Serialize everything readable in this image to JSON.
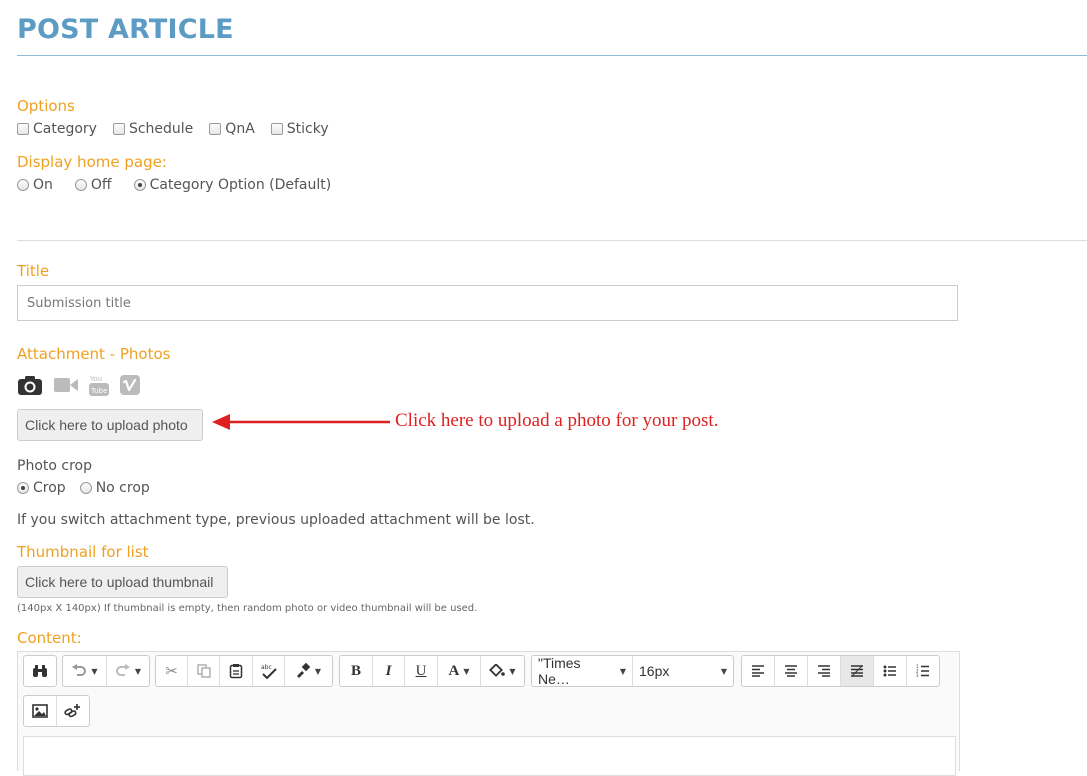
{
  "page": {
    "title": "POST ARTICLE"
  },
  "options": {
    "label": "Options",
    "checkboxes": [
      {
        "label": "Category",
        "checked": false
      },
      {
        "label": "Schedule",
        "checked": false
      },
      {
        "label": "QnA",
        "checked": false
      },
      {
        "label": "Sticky",
        "checked": false
      }
    ]
  },
  "display_home": {
    "label": "Display home page:",
    "radios": [
      {
        "label": "On",
        "selected": false
      },
      {
        "label": "Off",
        "selected": false
      },
      {
        "label": "Category Option (Default)",
        "selected": true
      }
    ]
  },
  "title_field": {
    "label": "Title",
    "placeholder": "Submission title"
  },
  "attachment": {
    "label": "Attachment - Photos",
    "types": [
      "camera-icon",
      "video-camera-icon",
      "youtube-icon",
      "vimeo-icon"
    ],
    "upload_label": "Click here to upload photo",
    "callout": "Click here to upload a photo for your post.",
    "crop_label": "Photo crop",
    "crop_options": [
      {
        "label": "Crop",
        "selected": true
      },
      {
        "label": "No crop",
        "selected": false
      }
    ],
    "warning": "If you switch attachment type, previous uploaded attachment will be lost."
  },
  "thumbnail": {
    "label": "Thumbnail for list",
    "upload_label": "Click here to upload thumbnail",
    "note": "(140px X 140px) If thumbnail is empty, then random photo or video thumbnail will be used."
  },
  "content": {
    "label": "Content:",
    "font_family": "\"Times Ne…",
    "font_size": "16px",
    "bold": "B",
    "italic": "I",
    "underline": "U",
    "text_color": "A"
  },
  "colors": {
    "accent": "#f0a020",
    "title": "#5b9bc4",
    "callout": "#e02020"
  }
}
